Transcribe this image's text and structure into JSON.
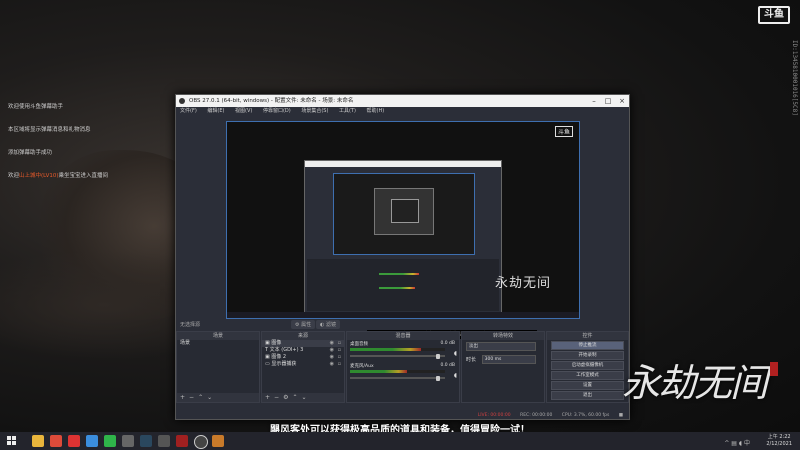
{
  "brand": {
    "logo": "斗鱼"
  },
  "side_id": "ID:1345810001016[5C8]",
  "chat": [
    {
      "text": "欢迎使用斗鱼弹幕助手"
    },
    {
      "text": "本区域将显示弹幕消息和礼物消息"
    },
    {
      "text": "添加弹幕助手成功"
    },
    {
      "prefix": "欢迎",
      "user": "山上城中(LV10)",
      "suffix": "乘坐宝宝进入直播间"
    }
  ],
  "obs": {
    "title": "OBS 27.0.1 (64-bit, windows) - 配置文件: 未命名 - 场景: 未命名",
    "menu": [
      "文件(F)",
      "编辑(E)",
      "视图(V)",
      "停靠窗口(D)",
      "场景集合(S)",
      "工具(T)",
      "帮助(H)"
    ],
    "preview_logo": "斗鱼",
    "preview_caption": "飓风客处可以获得极高品质的道具和装备，值得冒险一试！",
    "preview_callig": "永劫无间",
    "filter_label": "无选择源",
    "filter_tabs": [
      "属性",
      "滤镜"
    ],
    "docks": {
      "scenes": {
        "title": "场景",
        "items": [
          "场景"
        ]
      },
      "sources": {
        "title": "来源",
        "items": [
          "图像",
          "文本 (GDI+) 3",
          "图像 2",
          "显示器捕获"
        ]
      },
      "mixer": {
        "title": "混音器",
        "items": [
          {
            "name": "桌面音频",
            "db": "0.0 dB",
            "level": 0.75,
            "volume": 0.95
          },
          {
            "name": "麦克风/Aux",
            "db": "0.0 dB",
            "level": 0.6,
            "volume": 0.95
          }
        ]
      },
      "transitions": {
        "title": "转场特效",
        "type": "淡出",
        "duration_label": "时长",
        "duration": "300 ms"
      },
      "controls": {
        "title": "控件",
        "buttons": [
          "停止推流",
          "开始录制",
          "启动虚拟摄像机",
          "工作室模式",
          "设置",
          "退出"
        ]
      }
    },
    "status": {
      "live": "LIVE: 00:00:00",
      "rec": "REC: 00:00:00",
      "cpu": "CPU: 3.7%, 60.00 fps"
    }
  },
  "overlay_callig": "永劫无间",
  "subtitle": "飓风客处可以获得极高品质的道具和装备，值得冒险一试！",
  "taskbar": {
    "time": "上午 2:22",
    "date": "2/12/2021",
    "icons": [
      "file-explorer-icon",
      "chrome-icon",
      "netease-music-icon",
      "qq-icon",
      "wechat-icon",
      "app-icon",
      "steam-icon",
      "app-icon-2",
      "game-icon",
      "obs-icon",
      "app-icon-3"
    ],
    "icon_colors": [
      "#e9b53c",
      "#dd4b3a",
      "#d33",
      "#3b8ede",
      "#2fb54a",
      "#666",
      "#2a475e",
      "#555",
      "#a02020",
      "#444",
      "#c87a2a"
    ]
  }
}
